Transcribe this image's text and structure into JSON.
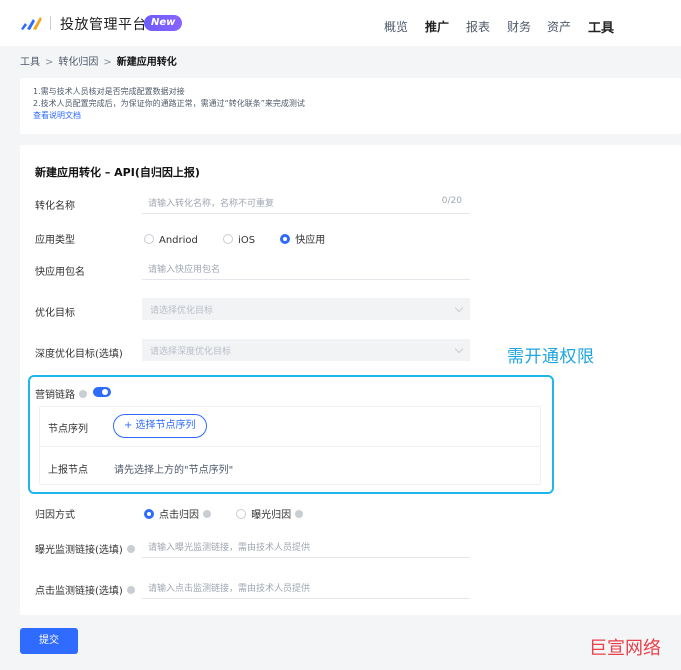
{
  "header": {
    "brand_title": "投放管理平台",
    "new_badge": "New",
    "nav": [
      "概览",
      "推广",
      "报表",
      "财务",
      "资产",
      "工具"
    ]
  },
  "breadcrumb": {
    "items": [
      "工具",
      "转化归因",
      "新建应用转化"
    ],
    "separator": ">"
  },
  "info": {
    "line1": "1.需与技术人员核对是否完成配置数据对接",
    "line2": "2.技术人员配置完成后，为保证你的通路正常，需通过“转化联条”来完成测试",
    "doc_link": "查看说明文档"
  },
  "form": {
    "title": "新建应用转化 – API(自归因上报)",
    "name_label": "转化名称",
    "name_placeholder": "请输入转化名称，名称不可重复",
    "name_counter": "0/20",
    "app_type_label": "应用类型",
    "app_type_options": [
      "Andriod",
      "iOS",
      "快应用"
    ],
    "app_type_selected": "快应用",
    "quick_app_label": "快应用包名",
    "quick_app_placeholder": "请输入快应用包名",
    "opt_target_label": "优化目标",
    "opt_target_placeholder": "请选择优化目标",
    "deep_target_label": "深度优化目标(选填)",
    "deep_target_placeholder": "请选择深度优化目标",
    "marketing_label": "营销链路",
    "marketing_enabled": true,
    "node_seq_label": "节点序列",
    "node_seq_button": "+ 选择节点序列",
    "upload_node_label": "上报节点",
    "upload_node_hint": "请先选择上方的\"节点序列\"",
    "attribution_label": "归因方式",
    "attribution_options": [
      "点击归因",
      "曝光归因"
    ],
    "attribution_selected": "点击归因",
    "exposure_label": "曝光监测链接(选填)",
    "exposure_placeholder": "请输入曝光监测链接，需由技术人员提供",
    "click_label": "点击监测链接(选填)",
    "click_placeholder": "请输入点击监测链接，需由技术人员提供",
    "submit_label": "提交"
  },
  "annotation": {
    "permission_note": "需开通权限"
  },
  "watermark": "巨宣网络",
  "colors": {
    "primary": "#2f6bff",
    "highlight_border": "#1fb6e9",
    "watermark": "#e9404a"
  }
}
